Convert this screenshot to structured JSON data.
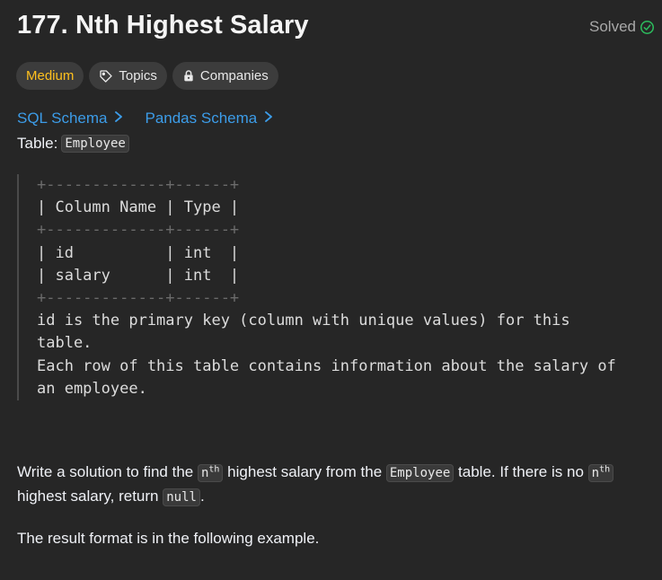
{
  "problem": {
    "number": "177.",
    "title": "Nth Highest Salary",
    "status": "Solved"
  },
  "tags": {
    "difficulty": "Medium",
    "topics": "Topics",
    "companies": "Companies"
  },
  "schemas": {
    "sql": "SQL Schema",
    "pandas": "Pandas Schema"
  },
  "table": {
    "label": "Table:",
    "name": "Employee"
  },
  "schema_table": {
    "border_top": "+-------------+------+",
    "header": "| Column Name | Type |",
    "border_mid": "+-------------+------+",
    "row1": "| id          | int  |",
    "row2": "| salary      | int  |",
    "border_bottom": "+-------------+------+",
    "note_line1": "id is the primary key (column with unique values) for this",
    "note_line2": "table.",
    "note_line3": "Each row of this table contains information about the salary of",
    "note_line4": "an employee."
  },
  "description": {
    "p1_part1": "Write a solution to find the ",
    "n_base": "n",
    "n_sup": "th",
    "p1_part2": " highest salary from the ",
    "table_code": "Employee",
    "p1_part3": " table. If there is no ",
    "p1_part4": " highest salary, return ",
    "null_code": "null",
    "p1_part5": ".",
    "p2": "The result format is in the following example."
  },
  "colors": {
    "background": "#262626",
    "difficulty_medium": "#ffc01e",
    "link": "#3c9ce8",
    "solved_check": "#2cbb5d"
  }
}
